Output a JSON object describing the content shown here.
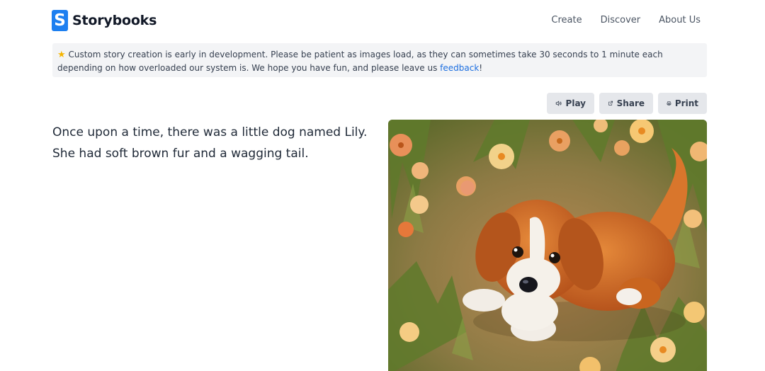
{
  "header": {
    "brand": "Storybooks",
    "logo_letter": "S",
    "nav": [
      {
        "label": "Create"
      },
      {
        "label": "Discover"
      },
      {
        "label": "About Us"
      }
    ]
  },
  "notice": {
    "icon": "star-icon",
    "text": "Custom story creation is early in development. Please be patient as images load, as they can sometimes take 30 seconds to 1 minute each depending on how overloaded our system is. We hope you have fun, and please leave us ",
    "link_label": "feedback",
    "suffix": "!"
  },
  "actions": {
    "play": {
      "label": "Play",
      "icon": "speaker-icon"
    },
    "share": {
      "label": "Share",
      "icon": "external-link-icon"
    },
    "print": {
      "label": "Print",
      "icon": "printer-icon"
    }
  },
  "story": {
    "text": "Once upon a time, there was a little dog named Lily. She had soft brown fur and a wagging tail."
  },
  "illustration": {
    "subject": "cartoon puppy in a flower meadow"
  },
  "colors": {
    "brand_blue": "#1d7ff0",
    "link_blue": "#1d6fe0",
    "notice_bg": "#f3f4f6",
    "button_bg": "#e5e7eb"
  }
}
